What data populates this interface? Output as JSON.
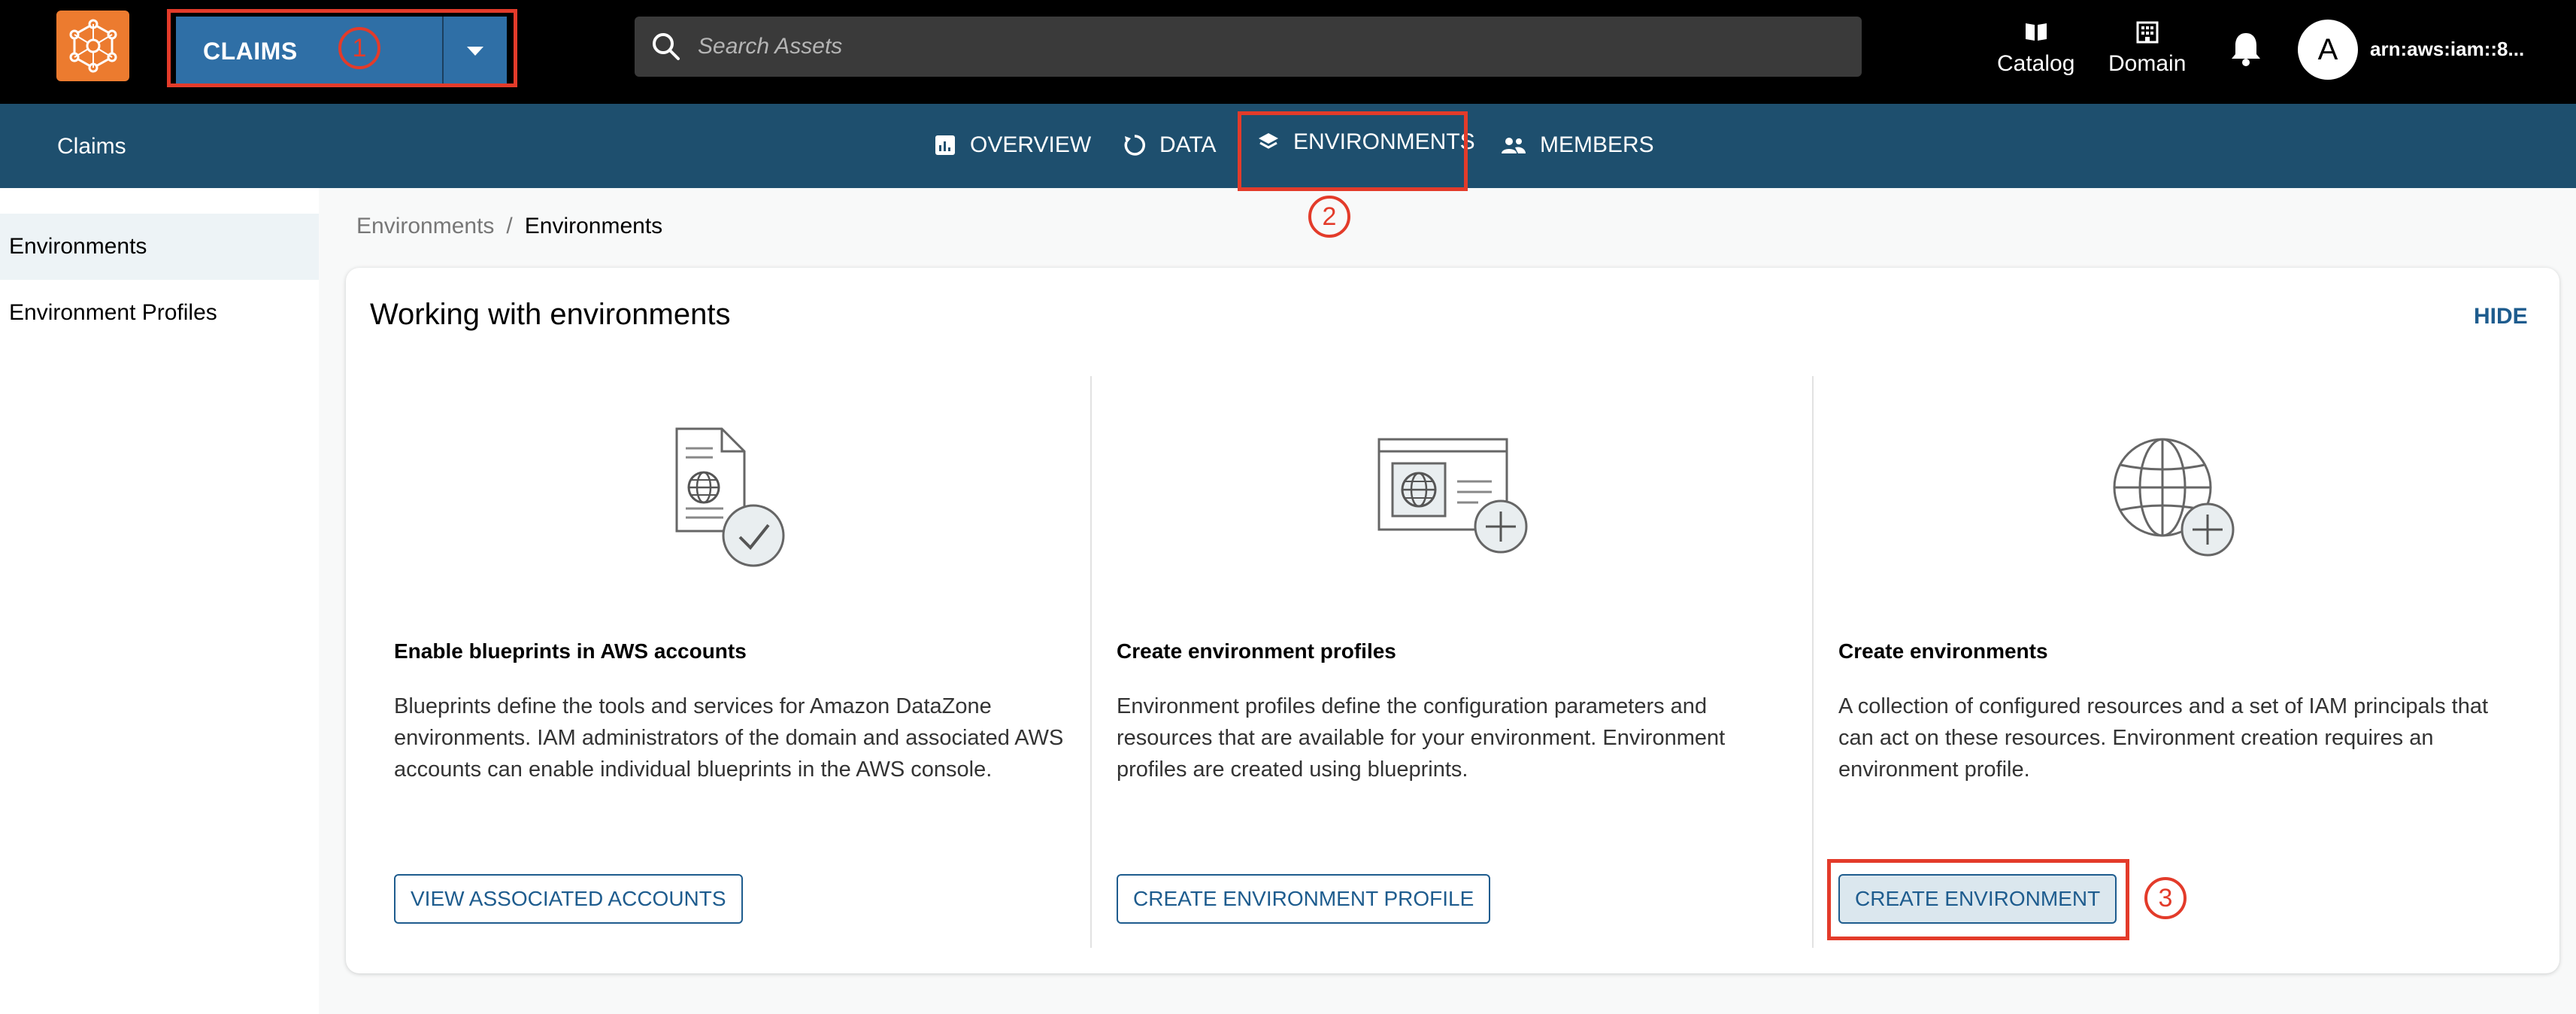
{
  "header": {
    "project_name": "CLAIMS",
    "search_placeholder": "Search Assets",
    "catalog_label": "Catalog",
    "domain_label": "Domain",
    "avatar_letter": "A",
    "user_arn": "arn:aws:iam::8..."
  },
  "subnav": {
    "project_label": "Claims",
    "tabs": [
      {
        "label": "OVERVIEW"
      },
      {
        "label": "DATA"
      },
      {
        "label": "ENVIRONMENTS"
      },
      {
        "label": "MEMBERS"
      }
    ]
  },
  "sidebar": {
    "items": [
      {
        "label": "Environments",
        "active": true
      },
      {
        "label": "Environment Profiles",
        "active": false
      }
    ]
  },
  "breadcrumb": {
    "parent": "Environments",
    "separator": "/",
    "current": "Environments"
  },
  "panel": {
    "title": "Working with environments",
    "hide_label": "HIDE",
    "columns": [
      {
        "icon": "document-check-icon",
        "title": "Enable blueprints in AWS accounts",
        "description": "Blueprints define the tools and services for Amazon DataZone environments. IAM administrators of the domain and associated AWS accounts can enable individual blueprints in the AWS console.",
        "button": "VIEW ASSOCIATED ACCOUNTS"
      },
      {
        "icon": "profile-add-icon",
        "title": "Create environment profiles",
        "description": "Environment profiles define the configuration parameters and resources that are available for your environment. Environment profiles are created using blueprints.",
        "button": "CREATE ENVIRONMENT PROFILE"
      },
      {
        "icon": "globe-add-icon",
        "title": "Create environments",
        "description": "A collection of configured resources and a set of IAM principals that can act on these resources. Environment creation requires an environment profile.",
        "button": "CREATE ENVIRONMENT"
      }
    ]
  },
  "annotations": {
    "step1": "1",
    "step2": "2",
    "step3": "3",
    "color": "#e33b2a"
  },
  "colors": {
    "topbar": "#000000",
    "subnav": "#1e4f6e",
    "logo": "#ec7b2f",
    "project_select": "#2f6fa6",
    "link": "#1e5c8e"
  }
}
